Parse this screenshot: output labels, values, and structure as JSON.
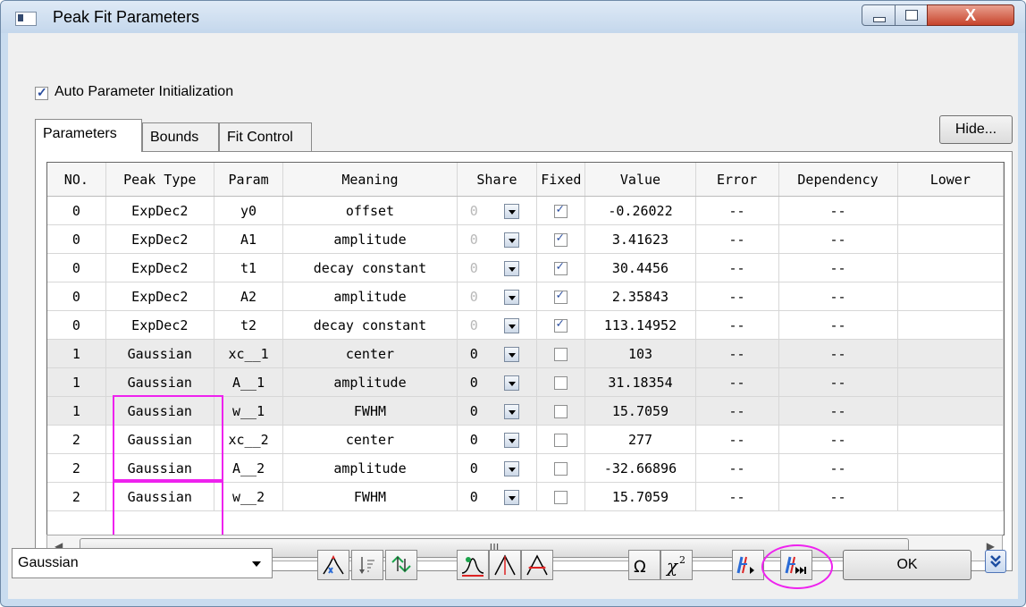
{
  "window": {
    "title": "Peak Fit Parameters",
    "close_label": "X"
  },
  "options": {
    "auto_init_label": "Auto Parameter Initialization",
    "auto_init_checked": true
  },
  "tabs": [
    {
      "label": "Parameters",
      "active": true
    },
    {
      "label": "Bounds"
    },
    {
      "label": "Fit Control"
    }
  ],
  "hide_label": "Hide...",
  "table": {
    "columns": [
      "NO.",
      "Peak Type",
      "Param",
      "Meaning",
      "Share",
      "Fixed",
      "Value",
      "Error",
      "Dependency",
      "Lower"
    ],
    "rows": [
      {
        "no": "0",
        "type": "ExpDec2",
        "param": "y0",
        "meaning": "offset",
        "share": "0",
        "fixed": true,
        "value": "-0.26022",
        "error": "--",
        "dependency": "--",
        "lower": ""
      },
      {
        "no": "0",
        "type": "ExpDec2",
        "param": "A1",
        "meaning": "amplitude",
        "share": "0",
        "fixed": true,
        "value": "3.41623",
        "error": "--",
        "dependency": "--",
        "lower": ""
      },
      {
        "no": "0",
        "type": "ExpDec2",
        "param": "t1",
        "meaning": "decay constant",
        "share": "0",
        "fixed": true,
        "value": "30.4456",
        "error": "--",
        "dependency": "--",
        "lower": ""
      },
      {
        "no": "0",
        "type": "ExpDec2",
        "param": "A2",
        "meaning": "amplitude",
        "share": "0",
        "fixed": true,
        "value": "2.35843",
        "error": "--",
        "dependency": "--",
        "lower": ""
      },
      {
        "no": "0",
        "type": "ExpDec2",
        "param": "t2",
        "meaning": "decay constant",
        "share": "0",
        "fixed": true,
        "value": "113.14952",
        "error": "--",
        "dependency": "--",
        "lower": ""
      },
      {
        "no": "1",
        "type": "Gaussian",
        "param": "xc__1",
        "meaning": "center",
        "share": "0",
        "fixed": false,
        "value": "103",
        "error": "--",
        "dependency": "--",
        "lower": ""
      },
      {
        "no": "1",
        "type": "Gaussian",
        "param": "A__1",
        "meaning": "amplitude",
        "share": "0",
        "fixed": false,
        "value": "31.18354",
        "error": "--",
        "dependency": "--",
        "lower": ""
      },
      {
        "no": "1",
        "type": "Gaussian",
        "param": "w__1",
        "meaning": "FWHM",
        "share": "0",
        "fixed": false,
        "value": "15.7059",
        "error": "--",
        "dependency": "--",
        "lower": ""
      },
      {
        "no": "2",
        "type": "Gaussian",
        "param": "xc__2",
        "meaning": "center",
        "share": "0",
        "fixed": false,
        "value": "277",
        "error": "--",
        "dependency": "--",
        "lower": ""
      },
      {
        "no": "2",
        "type": "Gaussian",
        "param": "A__2",
        "meaning": "amplitude",
        "share": "0",
        "fixed": false,
        "value": "-32.66896",
        "error": "--",
        "dependency": "--",
        "lower": ""
      },
      {
        "no": "2",
        "type": "Gaussian",
        "param": "w__2",
        "meaning": "FWHM",
        "share": "0",
        "fixed": false,
        "value": "15.7059",
        "error": "--",
        "dependency": "--",
        "lower": ""
      }
    ]
  },
  "scrollbar": {
    "grip": "III"
  },
  "bottom": {
    "peak_function": "Gaussian",
    "ok_label": "OK"
  },
  "colors": {
    "highlight": "#ee22ee",
    "shaded_row": "#ebebeb"
  }
}
